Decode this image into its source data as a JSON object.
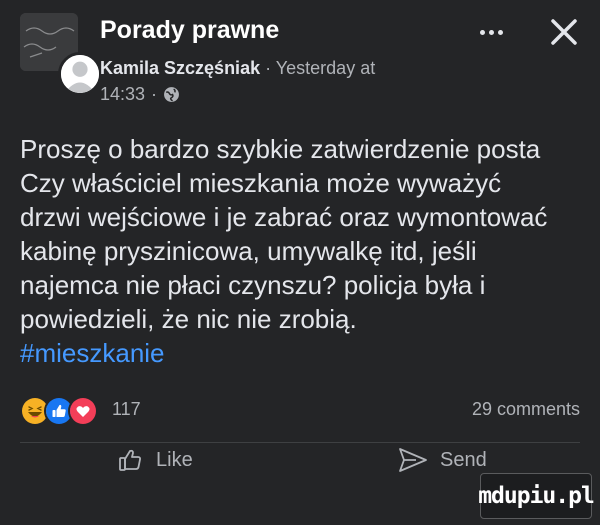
{
  "header": {
    "group_name": "Porady prawne",
    "author": "Kamila Szczęśniak",
    "separator": "·",
    "time_prefix": "Yesterday at",
    "time": "14:33",
    "audience_icon": "globe-icon"
  },
  "post": {
    "lines": [
      "Proszę o bardzo szybkie zatwierdzenie posta",
      "Czy właściciel mieszkania może wyważyć",
      "drzwi wejściowe i je zabrać oraz wymontować",
      "kabinę pryszinicowa, umywalkę itd, jeśli",
      "najemca nie płaci czynszu? policja była i",
      "powiedzieli, że nic nie zrobią."
    ],
    "hashtag": "#mieszkanie"
  },
  "reactions": {
    "icons": [
      "haha-icon",
      "like-icon",
      "love-icon"
    ],
    "count": "117",
    "comments": "29 comments"
  },
  "actions": {
    "like_label": "Like",
    "send_label": "Send"
  },
  "watermark": {
    "text": "mdupiu.pl"
  },
  "colors": {
    "background": "#242527",
    "text": "#e4e6eb",
    "muted": "#b0b3b8",
    "hashtag": "#4599ff",
    "like_blue": "#1877f2",
    "love_red": "#f33e58",
    "haha_yellow": "#f7b125"
  }
}
